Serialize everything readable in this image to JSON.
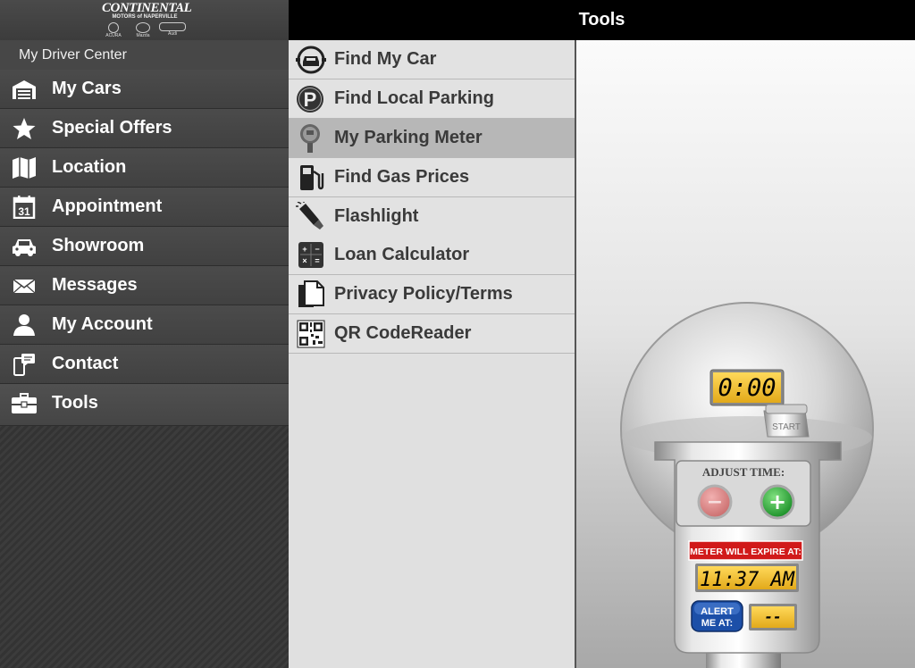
{
  "logo": {
    "brand": "CONTINENTAL",
    "subtitle": "MOTORS of NAPERVILLE",
    "makes": [
      "ACURA",
      "Mazda",
      "Audi"
    ]
  },
  "sidebar": {
    "header": "My Driver Center",
    "items": [
      {
        "label": "My Cars",
        "icon": "garage-icon"
      },
      {
        "label": "Special Offers",
        "icon": "star-icon"
      },
      {
        "label": "Location",
        "icon": "map-icon"
      },
      {
        "label": "Appointment",
        "icon": "calendar-icon"
      },
      {
        "label": "Showroom",
        "icon": "car-icon"
      },
      {
        "label": "Messages",
        "icon": "envelope-icon"
      },
      {
        "label": "My Account",
        "icon": "person-icon"
      },
      {
        "label": "Contact",
        "icon": "contact-icon"
      },
      {
        "label": "Tools",
        "icon": "toolbox-icon"
      }
    ],
    "calendar_day": "31"
  },
  "header": {
    "title": "Tools"
  },
  "tools": {
    "selected": "My Parking Meter",
    "items": [
      {
        "label": "Find My Car",
        "icon": "car-locator-icon"
      },
      {
        "label": "Find Local Parking",
        "icon": "parking-icon"
      },
      {
        "label": "My Parking Meter",
        "icon": "parking-meter-icon"
      },
      {
        "label": "Find Gas Prices",
        "icon": "gas-pump-icon"
      },
      {
        "label": "Flashlight",
        "icon": "flashlight-icon"
      },
      {
        "label": "Loan Calculator",
        "icon": "calculator-icon"
      },
      {
        "label": "Privacy Policy/Terms",
        "icon": "document-icon"
      },
      {
        "label": "QR CodeReader",
        "icon": "qr-code-icon"
      }
    ],
    "parking_letter": "P"
  },
  "meter": {
    "time_display": "0:00",
    "start_label": "START",
    "adjust_label": "ADJUST TIME:",
    "minus_symbol": "−",
    "plus_symbol": "+",
    "expire_label": "METER WILL EXPIRE AT:",
    "expire_time": "11:37 AM",
    "alert_line1": "ALERT",
    "alert_line2": "ME AT:",
    "alert_value": "--"
  },
  "colors": {
    "header_bg": "#000000",
    "selected_tool": "#b7b7b7",
    "lcd": "#f2c436",
    "expire_banner": "#d11a1a",
    "alert_button": "#1c4fa8",
    "plus_button": "#1f9e2c"
  }
}
